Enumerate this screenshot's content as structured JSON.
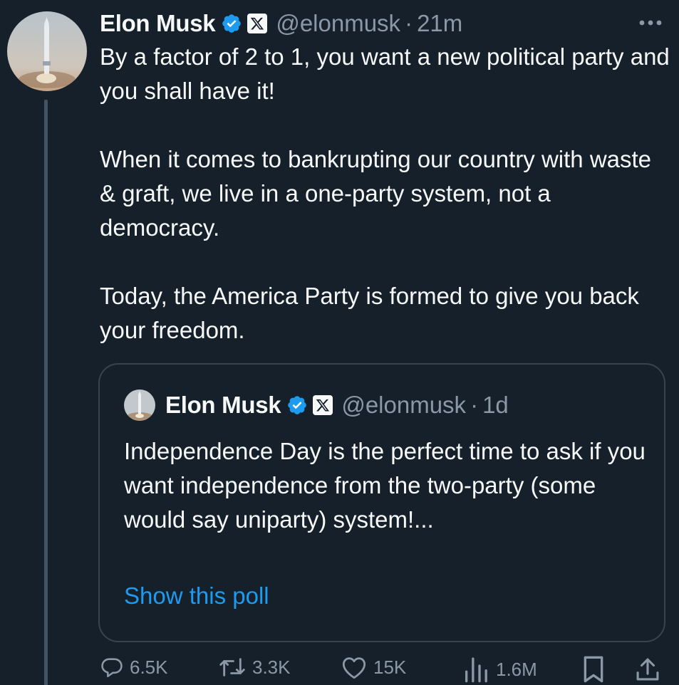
{
  "tweet": {
    "author_name": "Elon Musk",
    "handle": "@elonmusk",
    "separator": "·",
    "time": "21m",
    "paragraphs": [
      "By a factor of 2 to 1, you want a new political party and you shall have it!",
      "When it comes to bankrupting our country with waste & graft, we live in a one-party system, not a democracy.",
      "Today, the America Party is formed to give you back your freedom."
    ]
  },
  "quoted": {
    "author_name": "Elon Musk",
    "handle": "@elonmusk",
    "separator": "·",
    "time": "1d",
    "text": "Independence Day is the perfect time to ask if you want independence from the two-party (some would say uniparty) system!...",
    "poll_link": "Show this poll"
  },
  "actions": {
    "replies": "6.5K",
    "reposts": "3.3K",
    "likes": "15K",
    "views": "1.6M"
  },
  "colors": {
    "background": "#15202b",
    "text": "#f7f9f9",
    "muted": "#8b98a5",
    "link": "#1d9bf0",
    "verified": "#1d9bf0",
    "border": "#38444d"
  },
  "icons": [
    "more-icon",
    "verified-icon",
    "x-logo-icon",
    "reply-icon",
    "repost-icon",
    "like-icon",
    "views-icon",
    "bookmark-icon",
    "share-icon"
  ]
}
